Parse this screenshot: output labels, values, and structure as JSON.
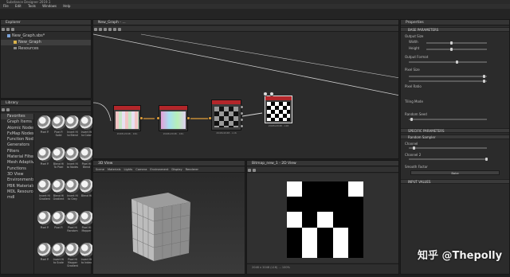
{
  "app": {
    "title": "Substance Designer 2019.1"
  },
  "menubar": {
    "items": [
      "File",
      "Edit",
      "Tools",
      "Windows",
      "Help"
    ]
  },
  "explorer": {
    "title": "Explorer",
    "root": "New_Graph.sbs*",
    "graph": "New_Graph",
    "resources": "Resources"
  },
  "graph_view": {
    "tab": "New_Graph - ...",
    "nodes": [
      {
        "label": "2048x2048 - 16b"
      },
      {
        "label": "2048x2048 - 16b"
      },
      {
        "label": "2048x2048 - L16"
      },
      {
        "label": "2048x2048 - L16"
      }
    ]
  },
  "library": {
    "title": "Library",
    "categories": [
      "Favorites",
      "Graph Items",
      "Atomic Nodes",
      "FxMap Nodes",
      "Function Nodes",
      "Generators",
      "Filters",
      "Material Filters",
      "Mesh Adaptive",
      "Functions",
      "3D View",
      "Environments",
      "PBR Materials",
      "MDL Resources",
      "mdl"
    ],
    "thumbs": [
      "Pixel P.",
      "Pixel P.\nSolid",
      "Invert Hi\nto Blend",
      "Invert Hi\nto Color",
      "Pixel P.",
      "Blend Hi\nTo Pixel",
      "Invert Hi\nto Nodes",
      "Pixel Hi\nBlend",
      "Invert Hi\nGradient",
      "Blend Hi\nGradient",
      "Invert Hi\nto Grey",
      "Blend Hi",
      "Pixel P.",
      "Pixel P.",
      "Pixel Hi\nRandom",
      "Pixel Hi\nMapper",
      "Pixel P.",
      "Invert Hi\nto Scale",
      "Pixel Hi\nMapper\nGradient",
      "Invert Hi\nto Index"
    ]
  },
  "view3d": {
    "title": "3D View",
    "menu": [
      "Scene",
      "Materials",
      "Lights",
      "Camera",
      "Environment",
      "Display",
      "Renderer"
    ]
  },
  "view2d": {
    "title": "Bitmap_new_1 - 2D View",
    "status": "2048 x 2048 (L16)  ...  100%"
  },
  "properties": {
    "title": "Properties",
    "sections": [
      "BASE PARAMETERS",
      "Output Size",
      "Output Format",
      "Pixel Size",
      "Pixel Ratio",
      "Tiling Mode",
      "Random Seed",
      "SPECIFIC PARAMETERS",
      "Random Sampler",
      "Channel",
      "Channel 2",
      "Smooth Factor",
      "Bake",
      "INPUT VALUES"
    ],
    "output_size": {
      "width_label": "Width",
      "height_label": "Height"
    },
    "button": "Bake"
  },
  "watermark": "知乎 @Thepolly"
}
